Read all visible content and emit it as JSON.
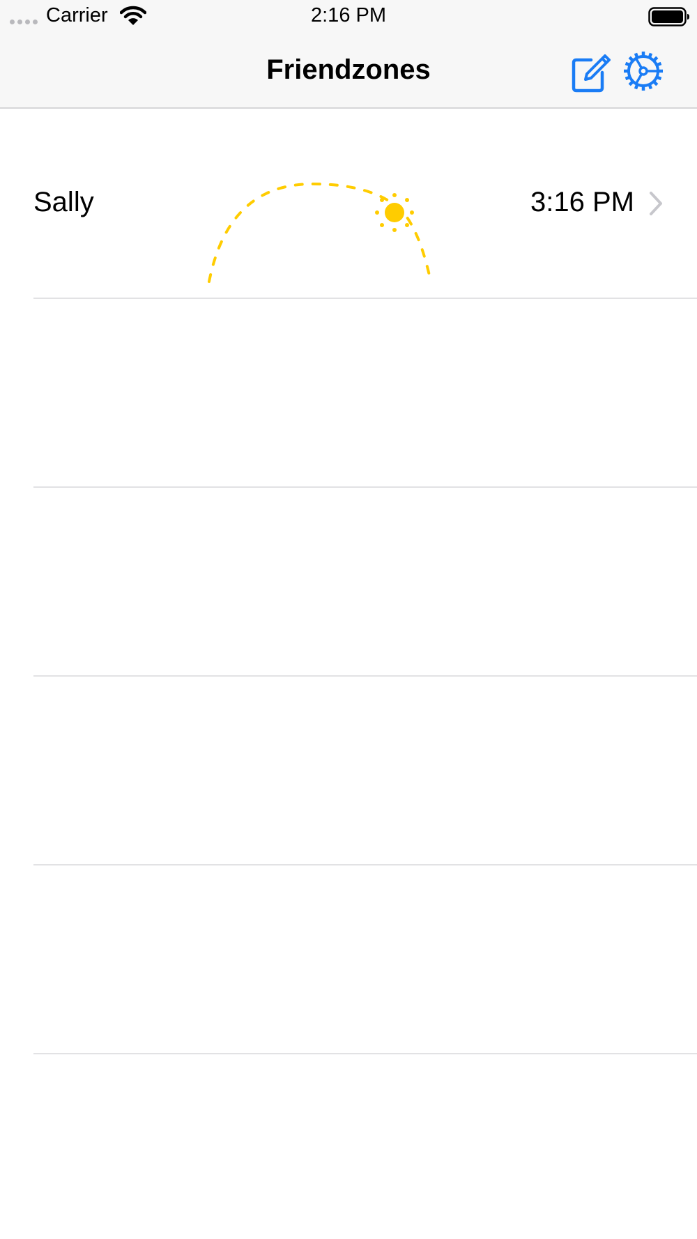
{
  "status_bar": {
    "carrier": "Carrier",
    "time": "2:16 PM",
    "icons": [
      "signal-dots-icon",
      "wifi-icon",
      "battery-icon"
    ]
  },
  "nav": {
    "title": "Friendzones",
    "buttons": [
      "compose-icon",
      "settings-icon"
    ],
    "accent_color": "#1a7cf5"
  },
  "friends": [
    {
      "name": "Sally",
      "time": "3:16 PM",
      "sun_color": "#ffcc00"
    }
  ],
  "colors": {
    "sun": "#ffcc00",
    "separator": "#e2e2e4",
    "chevron": "#c7c7cc"
  }
}
